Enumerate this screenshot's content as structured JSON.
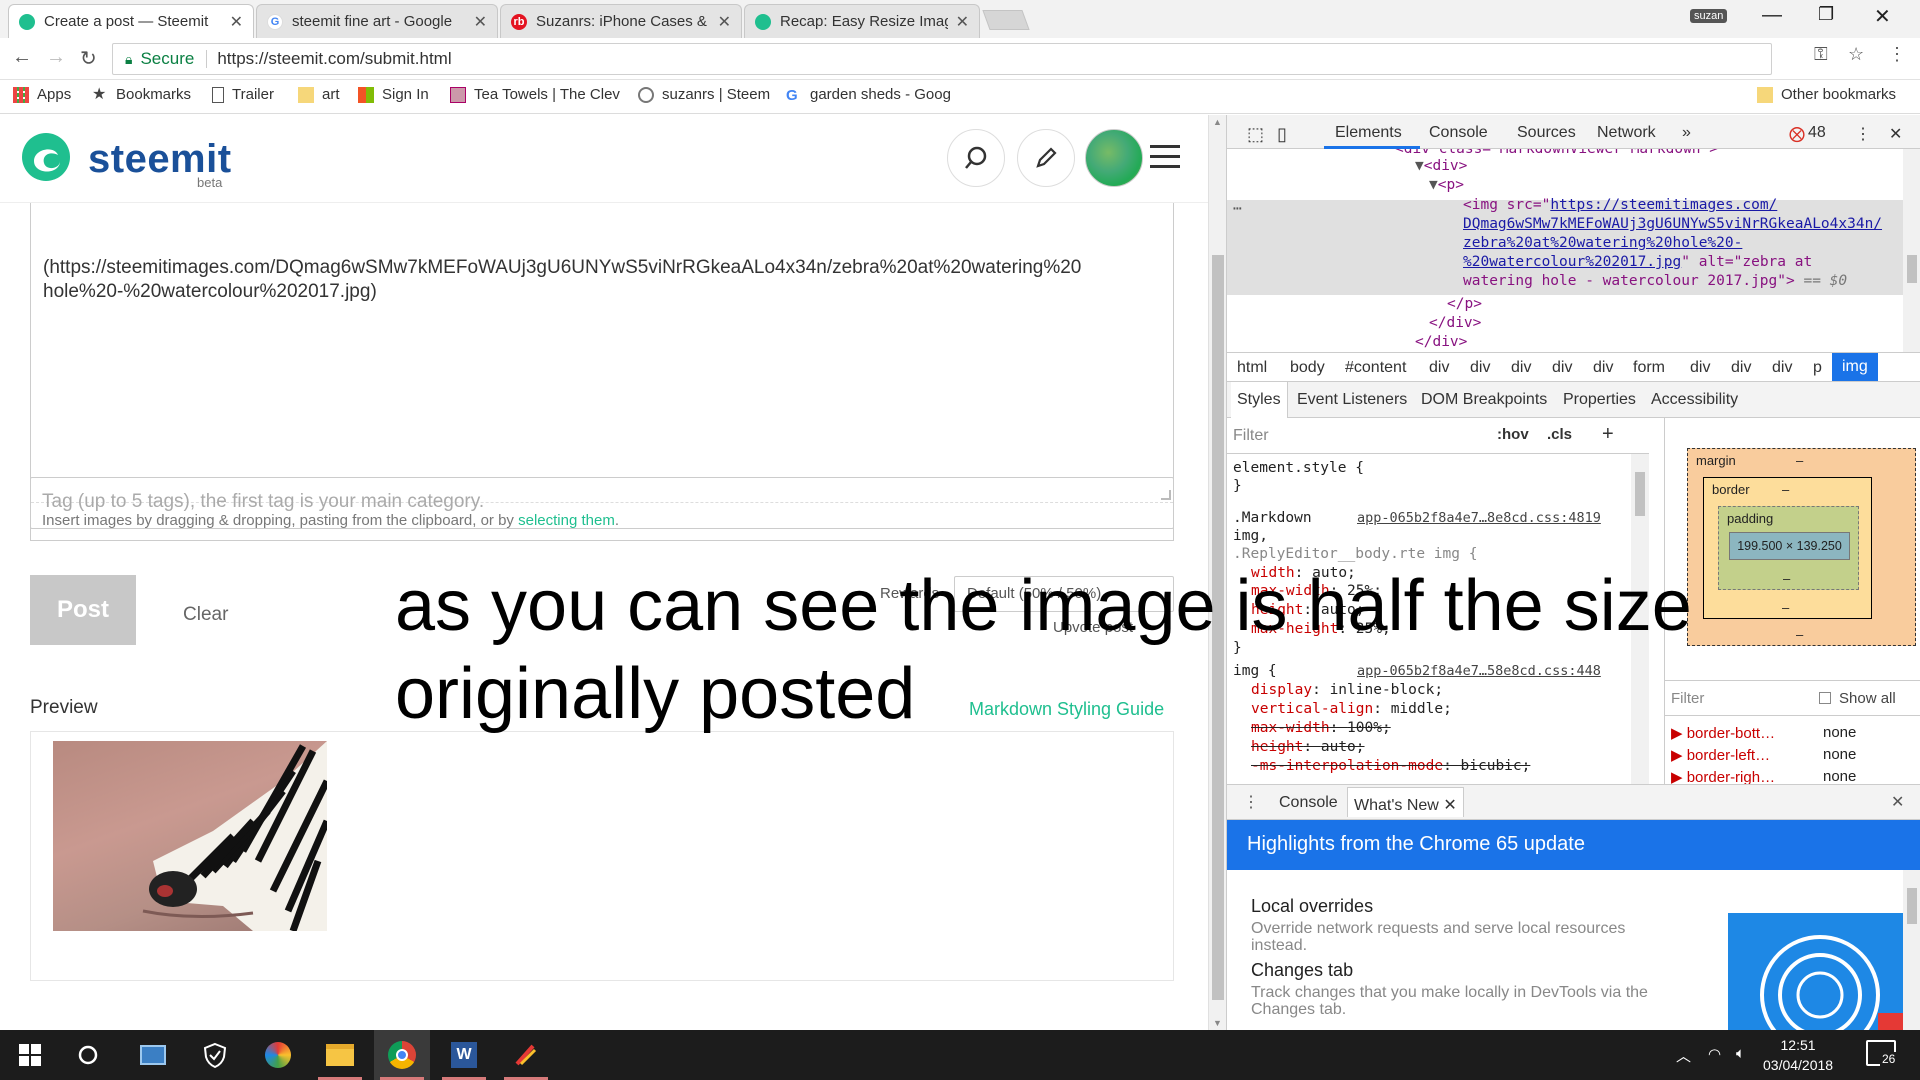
{
  "tabs": [
    {
      "title": "Create a post — Steemit",
      "favicon": "steemit-icon",
      "color": "#1fbf8f",
      "active": true
    },
    {
      "title": "steemit fine art - Google",
      "favicon": "google-icon",
      "color": "#4285f4"
    },
    {
      "title": "Suzanrs: iPhone Cases &",
      "favicon": "redbubble-icon",
      "color": "#e41321"
    },
    {
      "title": "Recap: Easy Resize Image",
      "favicon": "steemit-icon",
      "color": "#1fbf8f"
    }
  ],
  "profile_name": "suzan",
  "address": {
    "secure_label": "Secure",
    "url": "https://steemit.com/submit.html"
  },
  "bookmarks": [
    {
      "label": "Apps",
      "icon": "apps-grid-icon"
    },
    {
      "label": "Bookmarks",
      "icon": "star-icon"
    },
    {
      "label": "Trailer",
      "icon": "page-icon"
    },
    {
      "label": "art",
      "icon": "folder-icon"
    },
    {
      "label": "Sign In",
      "icon": "microsoft-icon"
    },
    {
      "label": "Tea Towels | The Clev",
      "icon": "redbubble-icon"
    },
    {
      "label": "suzanrs | Steem",
      "icon": "wordpress-icon"
    },
    {
      "label": "garden sheds - Goog",
      "icon": "google-icon"
    }
  ],
  "other_bookmarks": "Other bookmarks",
  "steemit": {
    "logo_text": "steemit",
    "logo_beta": "beta",
    "editor_text_line1": "(https://steemitimages.com/DQmag6wSMw7kMEFoWAUj3gU6UNYwS5viNrRGkeaALo4x34n/zebra%20at%20watering%20",
    "editor_text_line2": "hole%20-%20watercolour%202017.jpg)",
    "editor_hint_prefix": "Insert images by dragging & dropping, pasting from the clipboard, or by ",
    "editor_hint_link": "selecting them",
    "editor_hint_suffix": ".",
    "tags_placeholder": "Tag (up to 5 tags), the first tag is your main category.",
    "post_label": "Post",
    "clear_label": "Clear",
    "rewards_label": "Rewards",
    "rewards_value": "Default (50% / 50%)",
    "upvote_label": "Upvote post",
    "preview_label": "Preview",
    "markdown_guide": "Markdown Styling Guide"
  },
  "overlay": {
    "line1": "as you can see the image is half the size",
    "line2": "originally posted"
  },
  "devtools": {
    "tabs": [
      "Elements",
      "Console",
      "Sources",
      "Network"
    ],
    "error_count": "48",
    "dom": {
      "l0": "<div class=\"MarkdownViewer Markdown\">",
      "l1": "<div>",
      "l2": "<p>",
      "img_open": "<img src=\"",
      "img_src1": "https://steemitimages.com/",
      "img_src2": "DQmag6wSMw7kMEFoWAUj3gU6UNYwS5viNrRGkeaALo4x34n/",
      "img_src3": "zebra%20at%20watering%20hole%20-",
      "img_src4": "%20watercolour%202017.jpg",
      "img_alt_attr": "\" alt=\"zebra at",
      "img_alt2": "watering hole - watercolour 2017.jpg\">",
      "img_eq": " == $0",
      "l_close_p": "</p>",
      "l_close_div": "</div>",
      "l_close_div2": "</div>"
    },
    "breadcrumbs": [
      "html",
      "body",
      "#content",
      "div",
      "div",
      "div",
      "div",
      "div",
      "form",
      "div",
      "div",
      "div",
      "p",
      "img"
    ],
    "subtabs": [
      "Styles",
      "Event Listeners",
      "DOM Breakpoints",
      "Properties",
      "Accessibility"
    ],
    "filter_placeholder": "Filter",
    "hov": ":hov",
    "cls": ".cls",
    "styles": {
      "element_style": "element.style {",
      "close": "}",
      "rule1_sel1": ".Markdown",
      "rule1_src": "app-065b2f8a4e7…8e8cd.css:4819",
      "rule1_sel2": "img,",
      "rule1_sel3": ".ReplyEditor__body.rte img {",
      "p1": "width",
      "v1": "auto;",
      "p2": "max-width",
      "v2": "25%;",
      "p3": "height",
      "v3": "auto;",
      "p4": "max-height",
      "v4": "25%;",
      "rule2_sel": "img {",
      "rule2_src": "app-065b2f8a4e7…58e8cd.css:448",
      "q1": "display",
      "w1": "inline-block;",
      "q2": "vertical-align",
      "w2": "middle;",
      "q3": "max-width",
      "w3": "100%;",
      "q4": "height",
      "w4": "auto;",
      "q5": "-ms-interpolation-mode",
      "w5": "bicubic;"
    },
    "boxmodel": {
      "margin": "margin",
      "border": "border",
      "padding": "padding",
      "dash": "–",
      "content": "199.500 × 139.250"
    },
    "computed": {
      "filter": "Filter",
      "show_all": "Show all",
      "rows": [
        {
          "prop": "border-bott…",
          "val": "none"
        },
        {
          "prop": "border-left…",
          "val": "none"
        },
        {
          "prop": "border-righ…",
          "val": "none"
        }
      ]
    },
    "drawer_tabs": [
      "Console",
      "What's New"
    ],
    "whatsnew_title": "Highlights from the Chrome 65 update",
    "items": [
      {
        "title": "Local overrides",
        "desc": "Override network requests and serve local resources instead."
      },
      {
        "title": "Changes tab",
        "desc": "Track changes that you make locally in DevTools via the Changes tab."
      }
    ]
  },
  "taskbar": {
    "time": "12:51",
    "date": "03/04/2018",
    "notifications": "26"
  },
  "colors": {
    "steemit_green": "#1fbf8f",
    "steemit_blue": "#1a5099",
    "devtools_blue": "#1a73e8"
  }
}
